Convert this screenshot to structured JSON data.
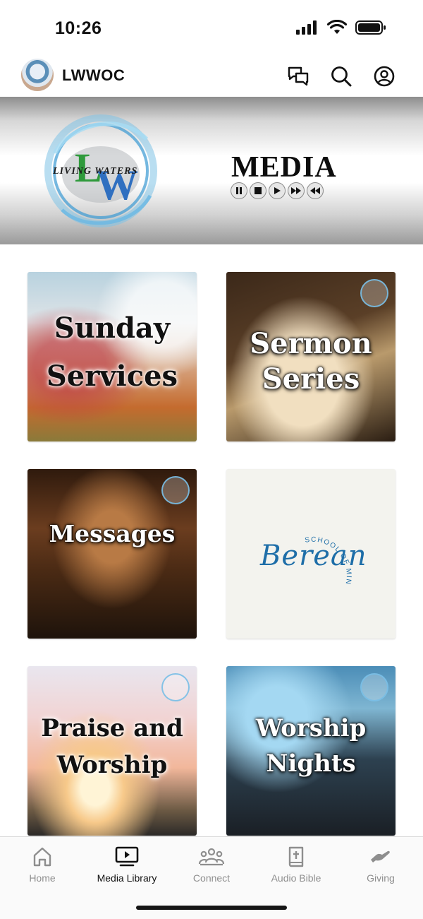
{
  "status_bar": {
    "time": "10:26",
    "icons": [
      "signal-icon",
      "wifi-icon",
      "battery-icon"
    ]
  },
  "header": {
    "app_name": "LWWOC",
    "actions": [
      "chat-icon",
      "search-icon",
      "profile-icon"
    ]
  },
  "banner": {
    "logo_text": "LIVING WATERS",
    "logo_letters": "LW",
    "title": "MEDIA",
    "controls": [
      "pause-icon",
      "stop-icon",
      "play-icon",
      "fast-forward-icon",
      "rewind-icon"
    ]
  },
  "tiles": [
    {
      "title_line1": "Sunday",
      "title_line2": "Services"
    },
    {
      "title_line1": "Sermon",
      "title_line2": "Series"
    },
    {
      "title_line1": "Messages"
    },
    {
      "logo_word": "Berean",
      "logo_arc": "SCHOOL OF MINISTRY"
    },
    {
      "title_line1": "Praise and",
      "title_line2": "Worship"
    },
    {
      "title_line1": "Worship",
      "title_line2": "Nights"
    }
  ],
  "nav": {
    "items": [
      {
        "label": "Home",
        "icon": "home-icon"
      },
      {
        "label": "Media Library",
        "icon": "media-library-icon",
        "active": true
      },
      {
        "label": "Connect",
        "icon": "connect-icon"
      },
      {
        "label": "Audio Bible",
        "icon": "bible-icon"
      },
      {
        "label": "Giving",
        "icon": "giving-icon"
      }
    ]
  },
  "colors": {
    "accent_blue": "#1e6ea8",
    "nav_inactive": "#8e8e8e",
    "nav_active": "#111111"
  }
}
